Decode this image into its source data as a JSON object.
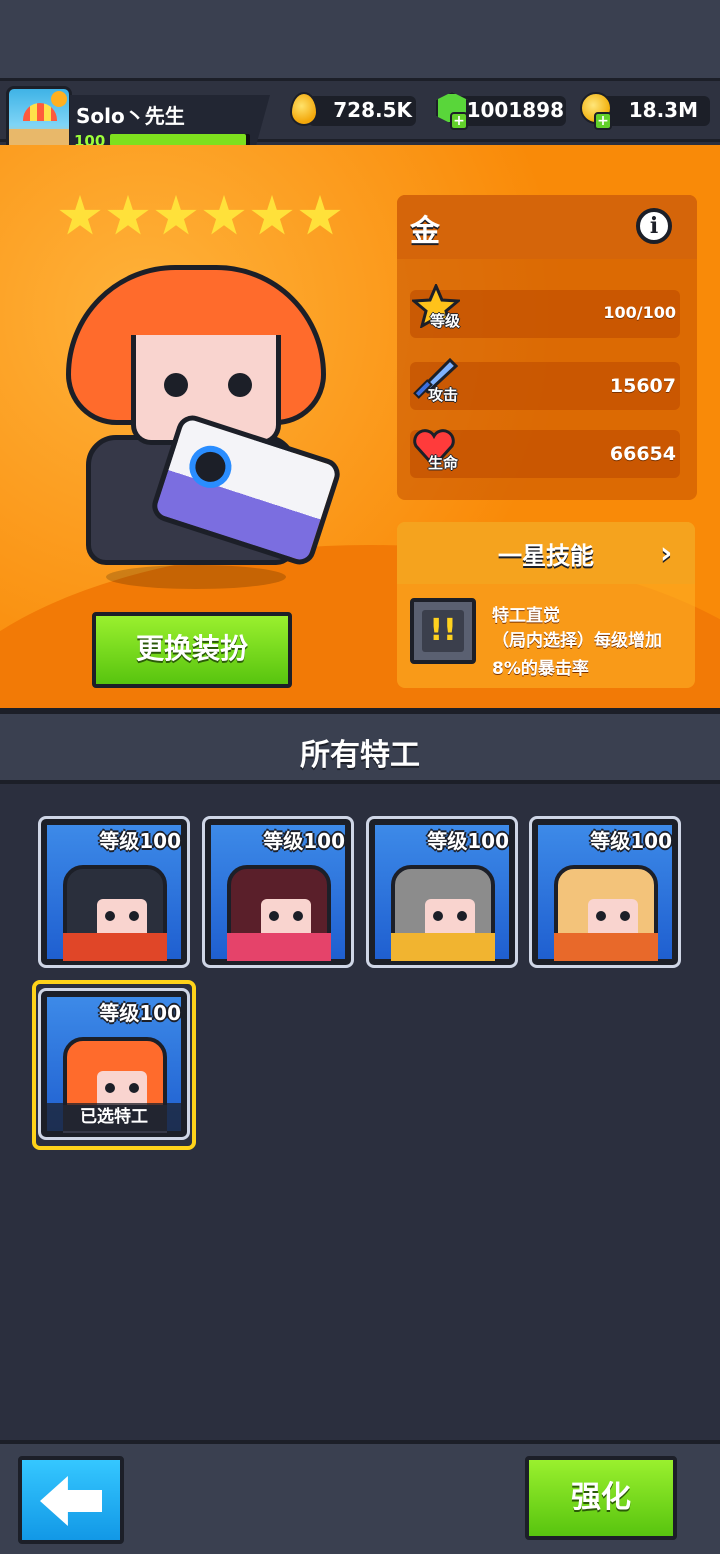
{
  "player": {
    "name": "Solo丶先生",
    "level": "100",
    "xp_fraction": 0.97
  },
  "resources": [
    {
      "icon": "drop-icon",
      "value": "728.5K"
    },
    {
      "icon": "gem-icon",
      "value": "1001898"
    },
    {
      "icon": "coin-icon",
      "value": "18.3M"
    }
  ],
  "hero": {
    "stars": 6,
    "rarity": "金",
    "outfit_button": "更换装扮"
  },
  "stats": [
    {
      "icon": "level-star-icon",
      "label": "等级",
      "value": "100/100"
    },
    {
      "icon": "sword-icon",
      "label": "攻击",
      "value": "15607"
    },
    {
      "icon": "heart-icon",
      "label": "生命",
      "value": "66654"
    }
  ],
  "skill": {
    "title": "一星技能",
    "name": "特工直觉",
    "description": "（局内选择）每级增加8%的暴击率"
  },
  "agents": {
    "title": "所有特工",
    "items": [
      {
        "level_label": "等级100",
        "hair": "#2a2f3c",
        "accent": "#e04628",
        "bg": "#3d8ae8"
      },
      {
        "level_label": "等级100",
        "hair": "#5a1f2a",
        "accent": "#e5436a",
        "bg": "#3d8ae8"
      },
      {
        "level_label": "等级100",
        "hair": "#8c8c8c",
        "accent": "#f1b430",
        "bg": "#3d8ae8"
      },
      {
        "level_label": "等级100",
        "hair": "#f3c37a",
        "accent": "#e8692a",
        "bg": "#3d8ae8"
      },
      {
        "level_label": "等级100",
        "hair": "#ff6b2c",
        "accent": "#363848",
        "bg": "#3d8ae8",
        "selected_label": "已选特工"
      }
    ]
  },
  "buttons": {
    "upgrade": "强化"
  }
}
